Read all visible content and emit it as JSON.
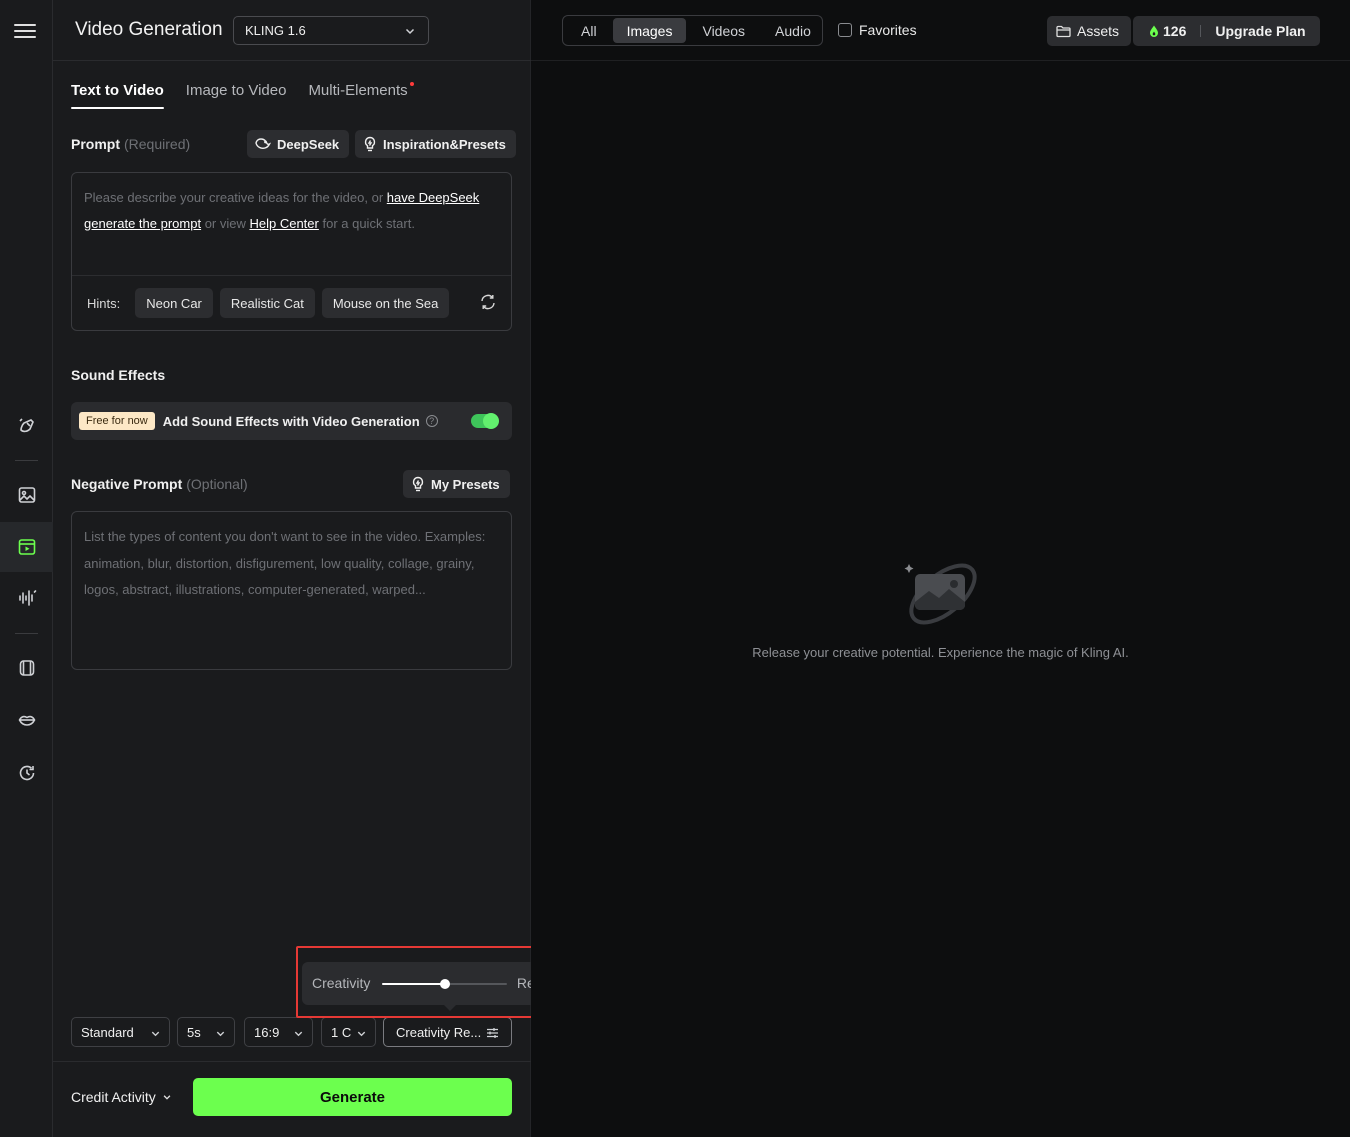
{
  "header": {
    "title": "Video Generation",
    "model": "KLING 1.6"
  },
  "tabs": [
    {
      "label": "Text to Video",
      "active": true
    },
    {
      "label": "Image to Video",
      "active": false
    },
    {
      "label": "Multi-Elements",
      "active": false,
      "has_dot": true
    }
  ],
  "prompt": {
    "label": "Prompt",
    "required": "(Required)",
    "deepseek_label": "DeepSeek",
    "presets_label": "Inspiration&Presets",
    "placeholder_a": "Please describe your creative ideas for the video, or ",
    "link_deepseek": "have DeepSeek generate the prompt",
    "placeholder_b": " or view ",
    "link_help": "Help Center",
    "placeholder_c": " for a quick start.",
    "hints_label": "Hints:",
    "hints": [
      "Neon Car",
      "Realistic Cat",
      "Mouse on the Sea"
    ]
  },
  "sound": {
    "label": "Sound Effects",
    "badge": "Free for now",
    "text": "Add Sound Effects with Video Generation",
    "help_icon": "?",
    "enabled": true
  },
  "negative": {
    "label": "Negative Prompt",
    "optional": "(Optional)",
    "presets_label": "My Presets",
    "placeholder": "List the types of content you don't want to see in the video. Examples: animation, blur, distortion, disfigurement, low quality, collage, grainy, logos, abstract, illustrations, computer-generated, warped..."
  },
  "controls": {
    "mode": "Standard",
    "duration": "5s",
    "aspect": "16:9",
    "count": "1 C",
    "creativity": "Creativity Re..."
  },
  "slider": {
    "left_label": "Creativity",
    "right_label": "Relevance",
    "value": 0.5
  },
  "footer": {
    "credit_label": "Credit Activity",
    "generate_label": "Generate"
  },
  "topbar": {
    "filters": [
      {
        "label": "All",
        "active": false
      },
      {
        "label": "Images",
        "active": true
      },
      {
        "label": "Videos",
        "active": false
      },
      {
        "label": "Audio",
        "active": false
      }
    ],
    "favorites_label": "Favorites",
    "assets_label": "Assets",
    "credits": "126",
    "upgrade_label": "Upgrade Plan"
  },
  "empty_state": {
    "message": "Release your creative potential. Experience the magic of Kling AI."
  },
  "colors": {
    "accent_green": "#6cff4e",
    "toggle_green": "#3ec45a",
    "highlight_red": "#e53935",
    "badge_bg": "#fde8c6"
  },
  "icons": {
    "menu": "hamburger-icon",
    "rail": [
      "magic-brush-icon",
      "image-icon",
      "video-icon",
      "audio-wave-icon",
      "avatar-frame-icon",
      "lips-icon",
      "history-icon"
    ]
  }
}
